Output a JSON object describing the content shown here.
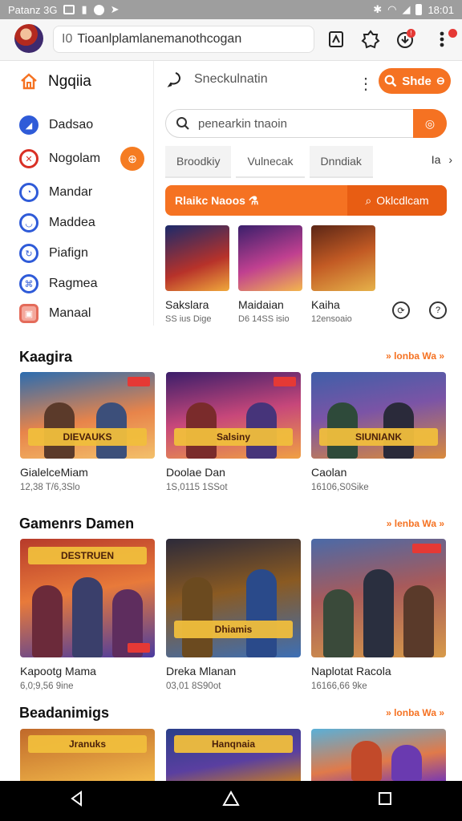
{
  "status": {
    "carrier": "Patanz 3G",
    "time": "18:01"
  },
  "browser": {
    "url": "Tioanlplamlanemanothcogan"
  },
  "sidebar": {
    "header": "Ngqiia",
    "items": [
      {
        "label": "Dadsao"
      },
      {
        "label": "Nogolam"
      },
      {
        "label": "Mandar"
      },
      {
        "label": "Maddea"
      },
      {
        "label": "Piafign"
      },
      {
        "label": "Ragmea"
      },
      {
        "label": "Manaal"
      }
    ]
  },
  "panel": {
    "title": "Sneckulnatin",
    "share_label": "Shde",
    "search_placeholder": "penearkin tnaoin",
    "tabs": [
      "Broodkiy",
      "Vulnecak",
      "Dnndiak"
    ],
    "tab_more": "Ia",
    "promo_label": "Rlaikc Naoos",
    "promo_button": "Oklcdlcam",
    "mini_cards": [
      {
        "title": "Sakslara",
        "sub": "SS ius Dige"
      },
      {
        "title": "Maidaian",
        "sub": "D6 14SS isio"
      },
      {
        "title": "Kaiha",
        "sub": "12ensoaio"
      }
    ]
  },
  "sections": [
    {
      "title": "Kaagira",
      "see_all": "» lonba Wa »",
      "cards": [
        {
          "title": "GialelceMiam",
          "sub": "12,38 T/6,3Slo",
          "banner": "DIEVAUKS"
        },
        {
          "title": "Doolae Dan",
          "sub": "1S,0115 1SSot",
          "banner": "Salsiny"
        },
        {
          "title": "Caolan",
          "sub": "16106,S0Sike",
          "banner": "SIUNIANK"
        }
      ]
    },
    {
      "title": "Gamenrs Damen",
      "see_all": "» lenba Wa »",
      "cards": [
        {
          "title": "Kapootg Mama",
          "sub": "6,0;9,56 9ine",
          "banner": "DESTRUEN"
        },
        {
          "title": "Dreka Mlanan",
          "sub": "03,01 8S90ot",
          "banner": "Dhiamis"
        },
        {
          "title": "Naplotat Racola",
          "sub": "16166,66 9ke",
          "banner": ""
        }
      ]
    },
    {
      "title": "Beadanimigs",
      "see_all": "» lonba Wa »",
      "cards": [
        {
          "title": "",
          "sub": "",
          "banner": "Jranuks"
        },
        {
          "title": "",
          "sub": "",
          "banner": "Hanqnaia"
        },
        {
          "title": "",
          "sub": "",
          "banner": ""
        }
      ]
    }
  ],
  "colors": {
    "accent": "#f57222",
    "accent_dark": "#e85d13",
    "nav_blue": "#2f5bd8"
  }
}
